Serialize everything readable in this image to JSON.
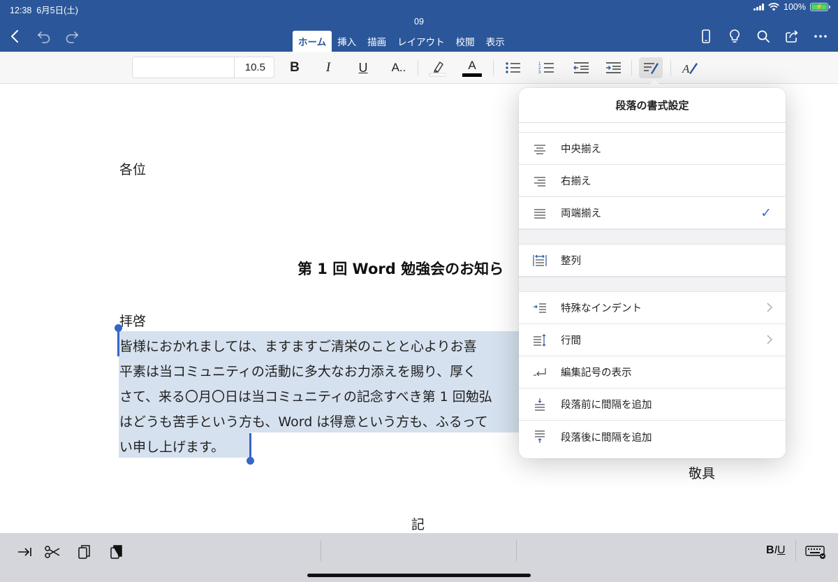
{
  "status_bar": {
    "time": "12:38",
    "date": "6月5日(土)",
    "battery": "100%"
  },
  "document_title": "09",
  "nav": {
    "back_icon": "chevron-left-icon",
    "undo_icon": "undo-icon",
    "redo_icon": "redo-icon"
  },
  "tabs": [
    {
      "label": "ホーム",
      "active": true
    },
    {
      "label": "挿入",
      "active": false
    },
    {
      "label": "描画",
      "active": false
    },
    {
      "label": "レイアウト",
      "active": false
    },
    {
      "label": "校閲",
      "active": false
    },
    {
      "label": "表示",
      "active": false
    }
  ],
  "ribbon": {
    "font_name": "",
    "font_size": "10.5",
    "bold_label": "B",
    "italic_label": "I",
    "underline_label": "U",
    "format_label": "A..",
    "font_color_letter": "A",
    "highlight_color": "#ffffff",
    "font_color": "#000000"
  },
  "document": {
    "addressee": "各位",
    "heading": "第 1 回 Word 勉強会のお知ら",
    "salutation": "拝啓",
    "body_lines": [
      "皆様におかれましては、ますますご清栄のことと心よりお喜",
      "平素は当コミュニティの活動に多大なお力添えを賜り、厚く",
      "さて、来る〇月〇日は当コミュニティの記念すべき第 1 回勉弘",
      "はどうも苦手という方も、Word は得意という方も、ふるって",
      "い申し上げます。"
    ],
    "closing": "敬具",
    "ki": "記"
  },
  "popover": {
    "title": "段落の書式設定",
    "rows": [
      {
        "label": "中央揃え",
        "icon": "align-center-icon"
      },
      {
        "label": "右揃え",
        "icon": "align-right-icon"
      },
      {
        "label": "両端揃え",
        "icon": "align-justify-icon",
        "checked": true
      },
      {
        "label": "整列",
        "icon": "distribute-icon"
      },
      {
        "label": "特殊なインデント",
        "icon": "special-indent-icon"
      },
      {
        "label": "行間",
        "icon": "line-spacing-icon"
      },
      {
        "label": "編集記号の表示",
        "icon": "formatting-marks-icon"
      },
      {
        "label": "段落前に間隔を追加",
        "icon": "space-before-icon"
      },
      {
        "label": "段落後に間隔を追加",
        "icon": "space-after-icon"
      }
    ],
    "accent_color": "#3b6fc9"
  },
  "bottom_bar": {
    "biu_label": "BIU"
  },
  "colors": {
    "topbar": "#2b579a",
    "selection": "#d6e1ef",
    "handle": "#3566c7"
  }
}
